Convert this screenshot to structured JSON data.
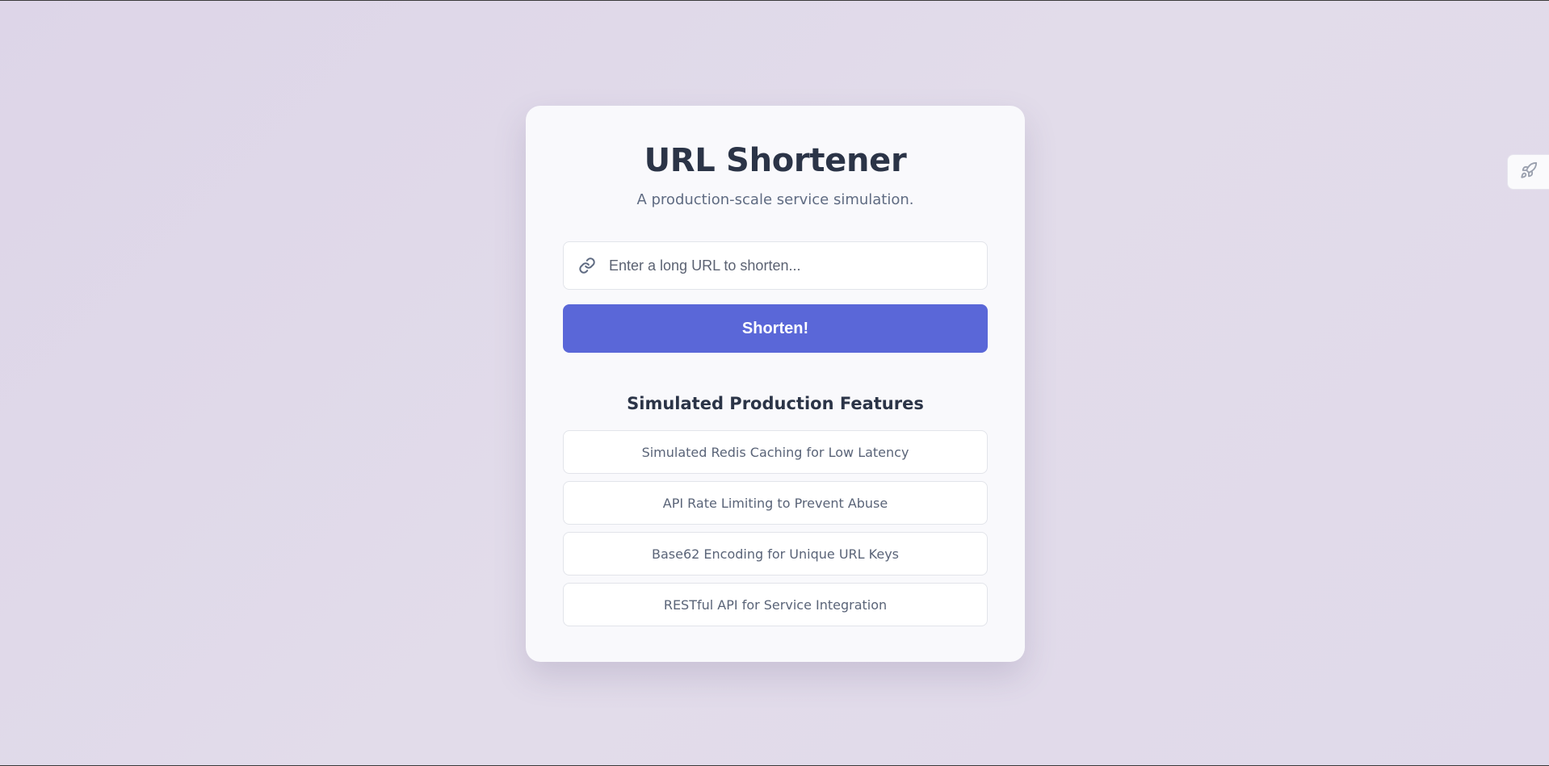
{
  "app": {
    "title": "URL Shortener",
    "subtitle": "A production-scale service simulation."
  },
  "form": {
    "input_placeholder": "Enter a long URL to shorten...",
    "input_value": "",
    "input_icon": "link-icon",
    "submit_label": "Shorten!"
  },
  "features": {
    "heading": "Simulated Production Features",
    "items": [
      {
        "label": "Simulated Redis Caching for Low Latency"
      },
      {
        "label": "API Rate Limiting to Prevent Abuse"
      },
      {
        "label": "Base62 Encoding for Unique URL Keys"
      },
      {
        "label": "RESTful API for Service Integration"
      }
    ]
  },
  "side_widget": {
    "icon": "rocket-icon"
  },
  "colors": {
    "accent": "#5a67d8",
    "background": "#e0d9ea",
    "card": "#f9f9fc",
    "title_text": "#2b3447",
    "muted_text": "#5f6b82"
  }
}
